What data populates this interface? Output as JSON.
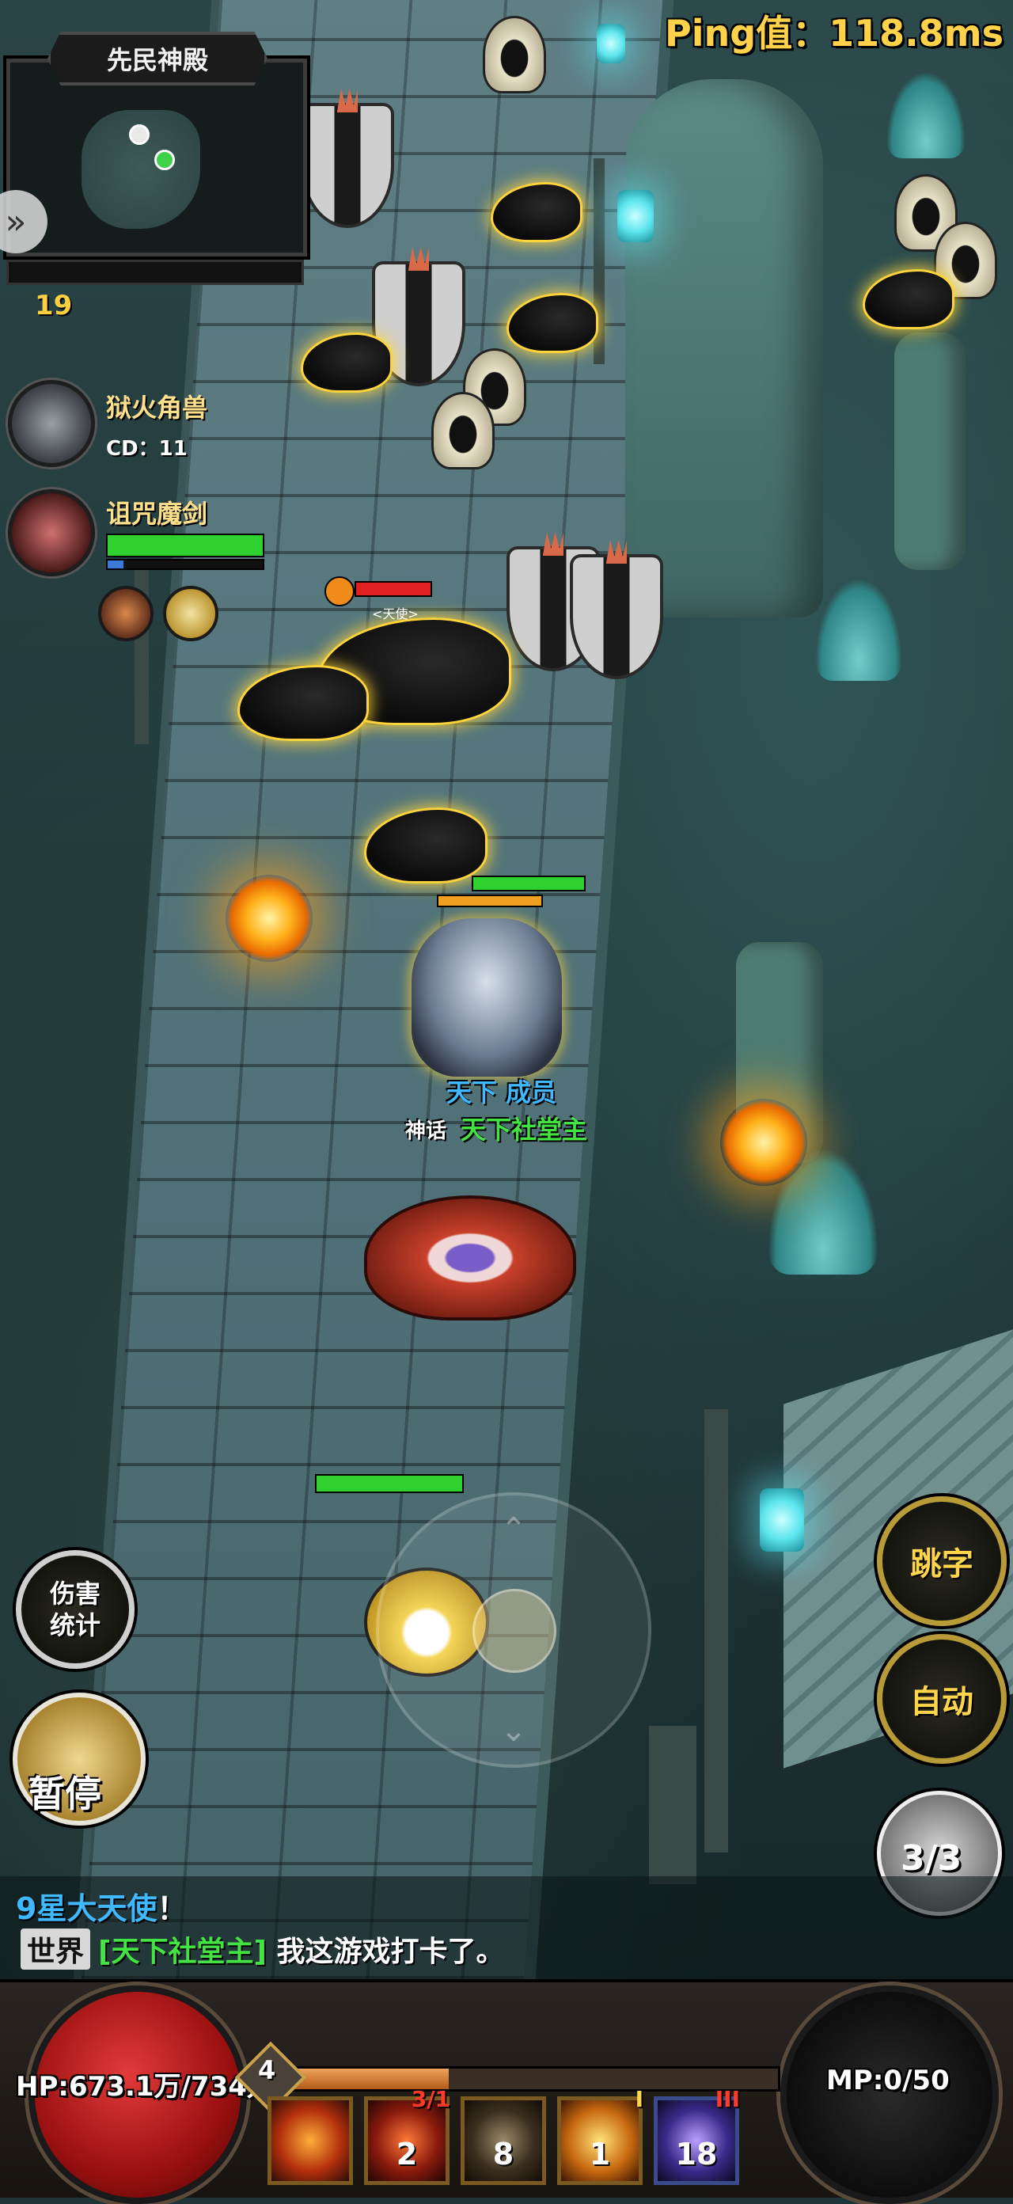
{
  "hud": {
    "ping_label": "Ping值：118.8ms"
  },
  "minimap": {
    "title": "先民神殿",
    "level": "19"
  },
  "buffs": [
    {
      "name": "狱火角兽",
      "cd": "CD：11"
    },
    {
      "name": "诅咒魔剑"
    }
  ],
  "player": {
    "guild_title": "天下 成员",
    "rank_label": "神话",
    "name": "天下社堂主"
  },
  "enemy_tag": "<天使>",
  "controls": {
    "damage_stats": "伤害\n统计",
    "pause": "暂停",
    "jump_text": "跳字",
    "auto": "自动",
    "potion_count": "3/3"
  },
  "chat": {
    "line1_prefix": "9星大天使",
    "line1_suffix": "！",
    "channel": "世界",
    "speaker": "[天下社堂主]",
    "message": "我这游戏打卡了。"
  },
  "status": {
    "hp": "HP:673.1万/734万",
    "mp": "MP:0/50",
    "level": "4",
    "exp_fraction": 0.35
  },
  "skills": [
    {
      "icon": "flame-burst-icon",
      "count": "",
      "badge": ""
    },
    {
      "icon": "fire-slash-icon",
      "count": "2",
      "badge": "3/1"
    },
    {
      "icon": "shadow-strike-icon",
      "count": "8",
      "badge": ""
    },
    {
      "icon": "holy-fire-icon",
      "count": "1",
      "badge": "I"
    },
    {
      "icon": "arcane-burst-icon",
      "count": "18",
      "badge": "III"
    }
  ],
  "colors": {
    "ping": "#ffd24a",
    "guild": "#3fb8ff",
    "player_name": "#44e344",
    "hp_bar": "#2fd12f",
    "buff_name": "#ffe08a"
  }
}
